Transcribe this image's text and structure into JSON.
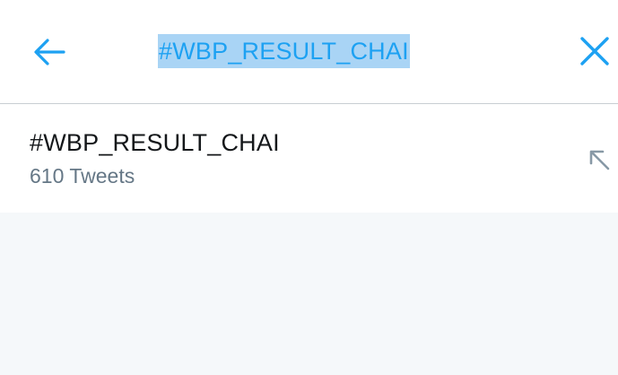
{
  "search": {
    "query": "#WBP_RESULT_CHAI",
    "back_icon": "arrow-left-icon",
    "clear_icon": "close-icon"
  },
  "suggestions": [
    {
      "title": "#WBP_RESULT_CHAI",
      "subtitle": "610 Tweets",
      "action_icon": "arrow-up-left-icon"
    }
  ],
  "colors": {
    "accent": "#1da1f2",
    "selection": "#a9d4f5",
    "text_primary": "#14171a",
    "text_secondary": "#657786",
    "divider": "#c8ced3",
    "background": "#f5f8fa"
  }
}
